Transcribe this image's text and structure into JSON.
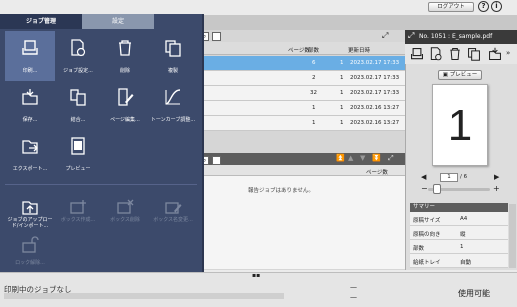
{
  "top": {
    "login_label": "ログアウト",
    "help_icon": "help-icon",
    "info_icon": "info-icon"
  },
  "tabs": [
    {
      "label": "ジョブ管理"
    },
    {
      "label": "設定"
    }
  ],
  "menu": {
    "items": [
      {
        "label": "印刷...",
        "icon": "print-icon"
      },
      {
        "label": "ジョブ設定...",
        "icon": "job-settings-icon"
      },
      {
        "label": "削除",
        "icon": "trash-icon"
      },
      {
        "label": "複製",
        "icon": "copy-icon"
      },
      {
        "label": "保存...",
        "icon": "save-icon"
      },
      {
        "label": "結合...",
        "icon": "merge-icon"
      },
      {
        "label": "ページ編集...",
        "icon": "page-edit-icon"
      },
      {
        "label": "トーンカーブ調整...",
        "icon": "tone-curve-icon"
      },
      {
        "label": "エクスポート...",
        "icon": "export-icon"
      },
      {
        "label": "プレビュー",
        "icon": "preview-icon"
      }
    ],
    "items2": [
      {
        "label": "ジョブのアップロード/インポート...",
        "icon": "upload-icon"
      },
      {
        "label": "ボックス作成...",
        "icon": "box-create-icon"
      },
      {
        "label": "ボックス削除",
        "icon": "box-delete-icon"
      },
      {
        "label": "ボックス名変更...",
        "icon": "box-rename-icon"
      },
      {
        "label": "ロック解除...",
        "icon": "unlock-icon"
      }
    ]
  },
  "list": {
    "headers": {
      "pages": "ページ数",
      "copies": "部数",
      "date": "更新日時"
    },
    "rows": [
      {
        "pages": "6",
        "copies": "1",
        "date": "2023.02.17 17:33"
      },
      {
        "pages": "2",
        "copies": "1",
        "date": "2023.02.17 17:33"
      },
      {
        "pages": "32",
        "copies": "1",
        "date": "2023.02.17 17:33"
      },
      {
        "pages": "1",
        "copies": "1",
        "date": "2023.02.16 13:27"
      },
      {
        "pages": "1",
        "copies": "1",
        "date": "2023.02.16 13:27"
      }
    ]
  },
  "lower": {
    "header": "ページ数",
    "empty": "報告ジョブはありません。"
  },
  "right": {
    "title": "No. 1051 : E_sample.pdf",
    "preview_label": "プレビュー",
    "thumb_number": "1",
    "page_value": "1",
    "page_total": "/ 6",
    "summary_label": "サマリー",
    "summary": [
      {
        "key": "原稿サイズ",
        "value": "A4"
      },
      {
        "key": "原稿の向き",
        "value": "縦"
      },
      {
        "key": "部数",
        "value": "1"
      },
      {
        "key": "給紙トレイ",
        "value": "自動"
      }
    ]
  },
  "bottom": {
    "no_job": "印刷中のジョブなし",
    "status": "使用可能",
    "dash": "—"
  }
}
